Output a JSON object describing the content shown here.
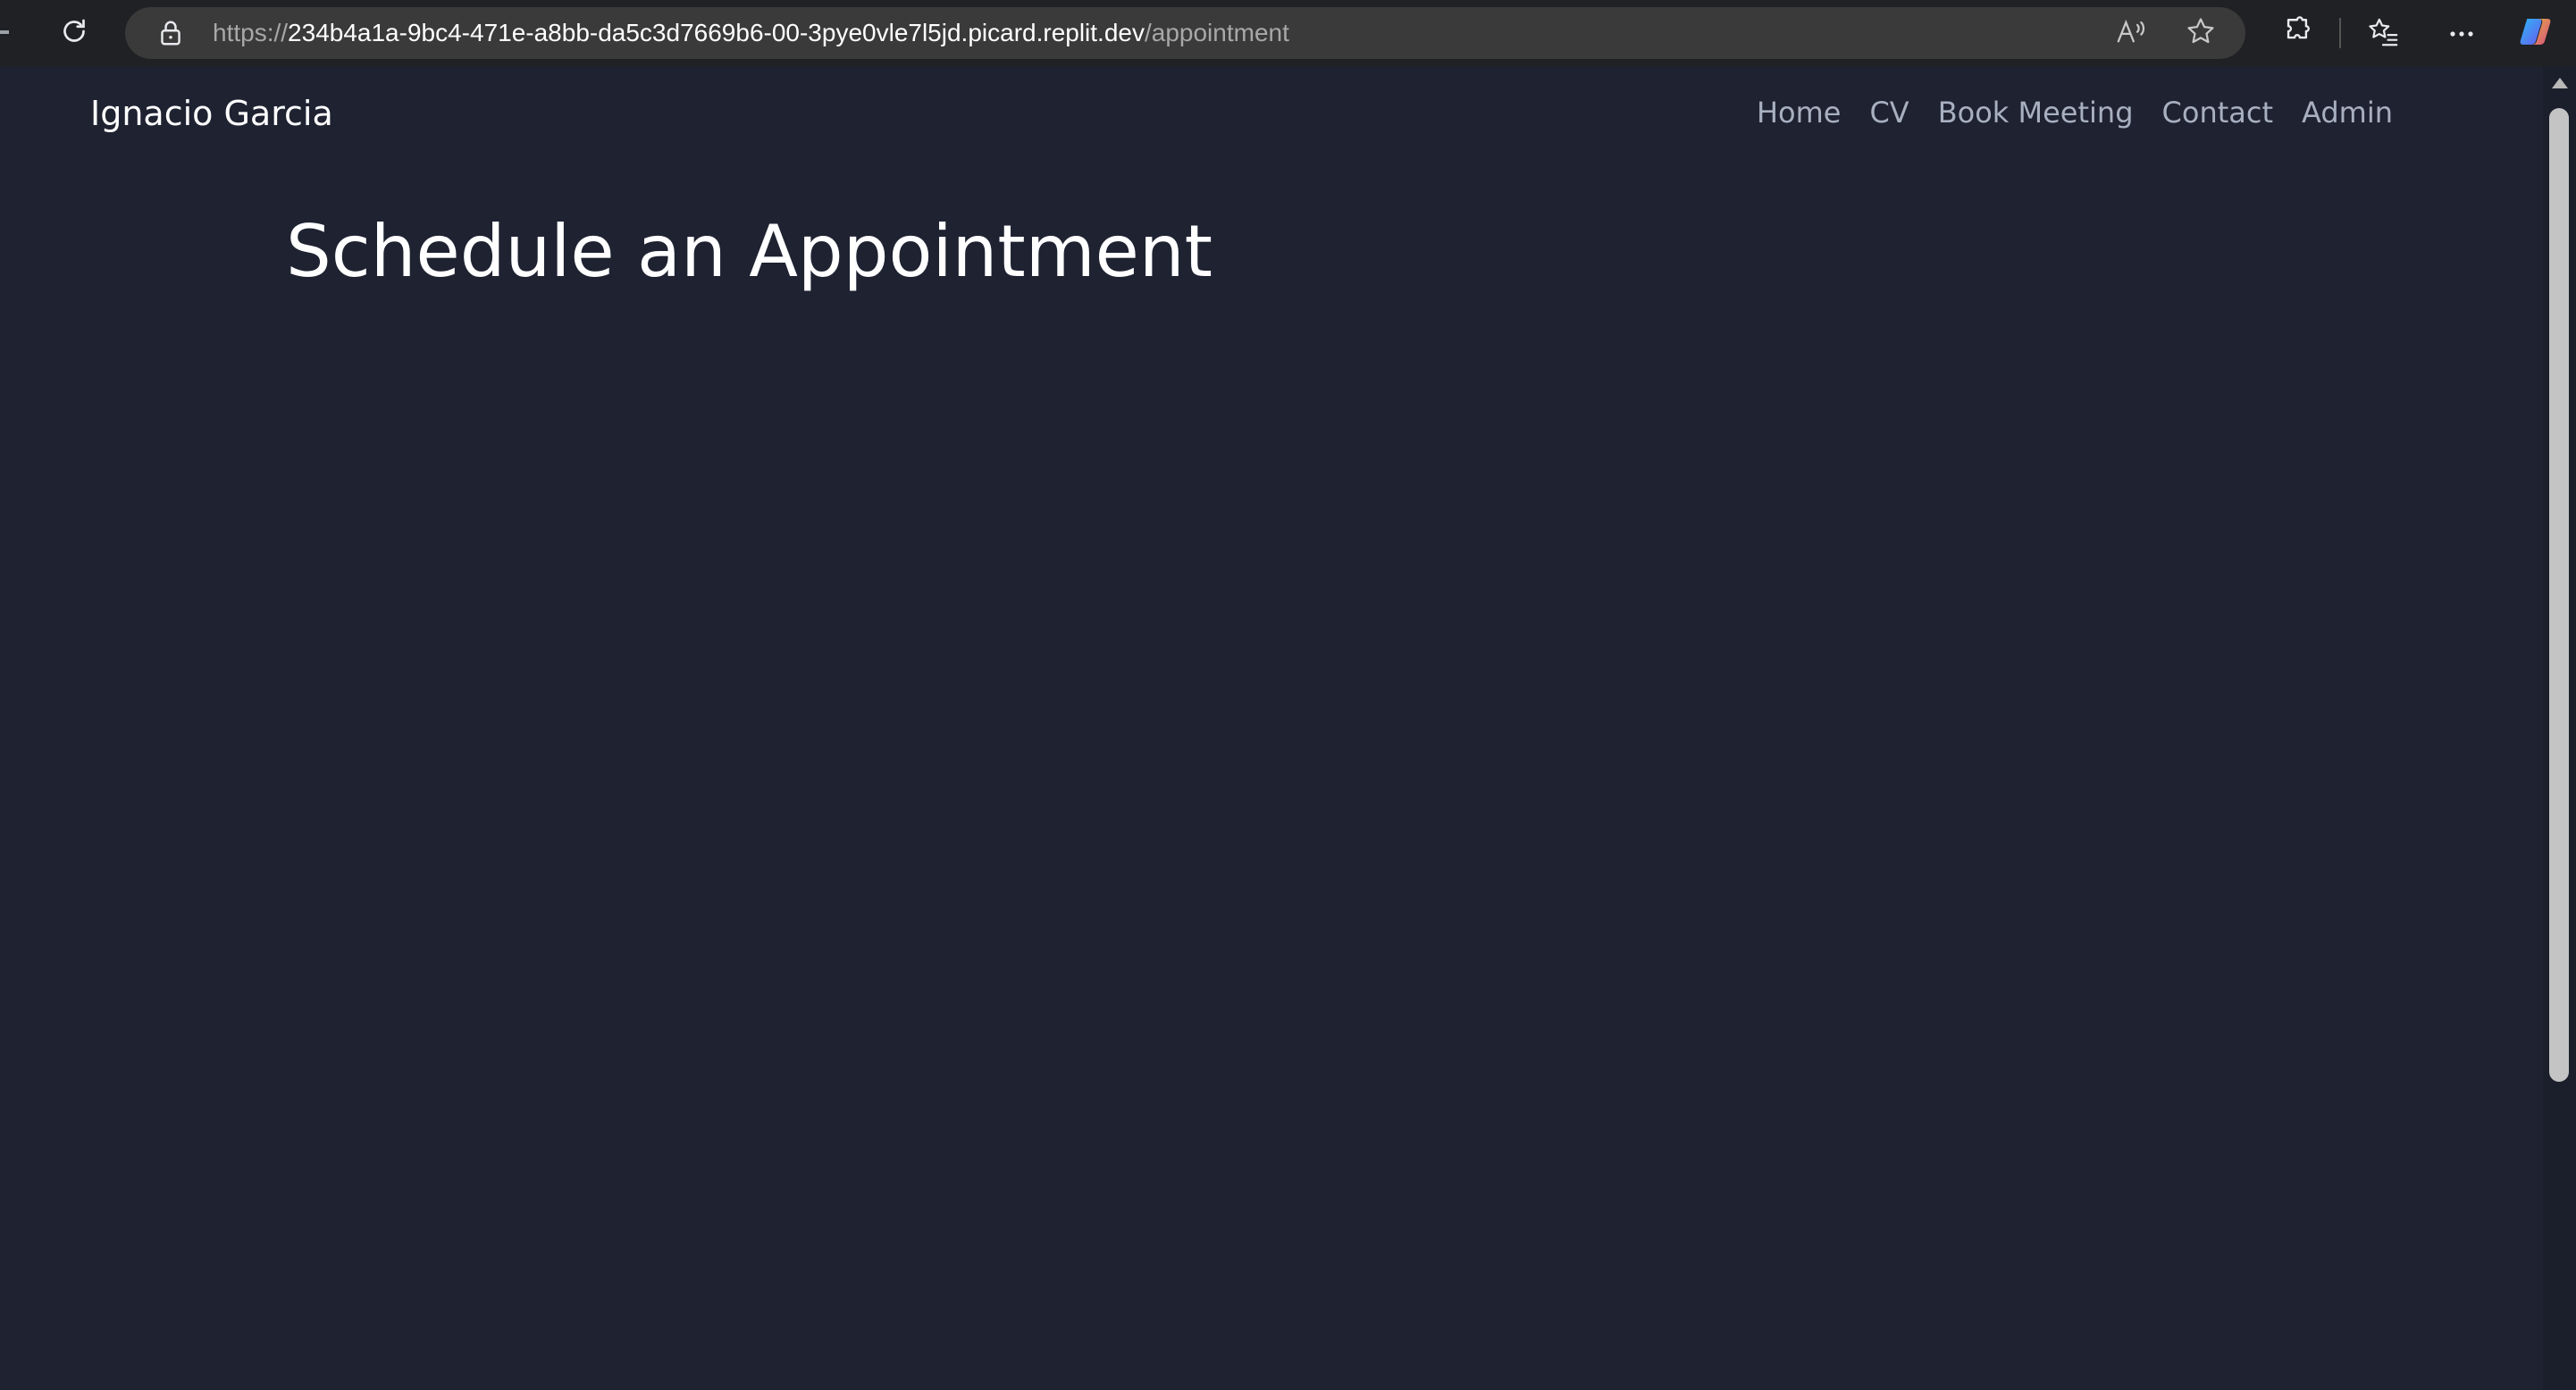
{
  "browser": {
    "url_scheme": "https://",
    "url_host": "234b4a1a-9bc4-471e-a8bb-da5c3d7669b6-00-3pye0vle7l5jd.picard.replit.dev",
    "url_path": "/appointment",
    "icons": [
      "reload-icon",
      "lock-icon",
      "read-aloud-icon",
      "favorite-star-icon",
      "extensions-icon",
      "favorites-list-icon",
      "more-options-icon",
      "copilot-icon"
    ]
  },
  "site": {
    "brand": "Ignacio Garcia",
    "nav": {
      "home": "Home",
      "cv": "CV",
      "book_meeting": "Book Meeting",
      "contact": "Contact",
      "admin": "Admin"
    }
  },
  "main": {
    "title": "Schedule an Appointment"
  },
  "colors": {
    "page_background": "#1e2231",
    "chrome_background": "#202124",
    "address_bar": "#3a3a3a",
    "nav_link": "#a8b0c0",
    "text": "#ffffff"
  }
}
